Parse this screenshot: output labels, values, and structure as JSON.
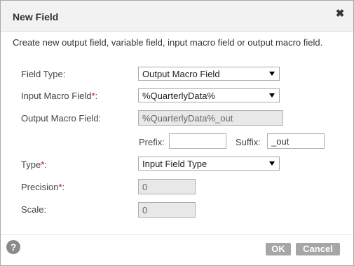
{
  "dialog": {
    "title": "New Field",
    "close_glyph": "✖",
    "description": "Create new output field, variable field, input macro field or output macro field."
  },
  "form": {
    "field_type": {
      "label": "Field Type:",
      "value": "Output Macro Field"
    },
    "input_macro_field": {
      "label": "Input Macro Field",
      "required_mark": "*",
      "colon": ":",
      "value": "%QuarterlyData%"
    },
    "output_macro_field": {
      "label": "Output Macro Field:",
      "value": "%QuarterlyData%_out"
    },
    "prefix": {
      "label": "Prefix:",
      "value": ""
    },
    "suffix": {
      "label": "Suffix:",
      "value": "_out"
    },
    "type": {
      "label": "Type",
      "required_mark": "*",
      "colon": ":",
      "value": "Input Field Type"
    },
    "precision": {
      "label": "Precision",
      "required_mark": "*",
      "colon": ":",
      "value": "0"
    },
    "scale": {
      "label": "Scale:",
      "value": "0"
    }
  },
  "footer": {
    "help_glyph": "?",
    "ok_label": "OK",
    "cancel_label": "Cancel"
  },
  "icons": {
    "close": "close-icon",
    "help": "help-icon",
    "dropdown": "chevron-down-icon"
  },
  "colors": {
    "required": "#cc0000",
    "button": "#a6a6a6",
    "titlebar": "#f2f2f2",
    "readonly_field": "#e8e8e8"
  }
}
